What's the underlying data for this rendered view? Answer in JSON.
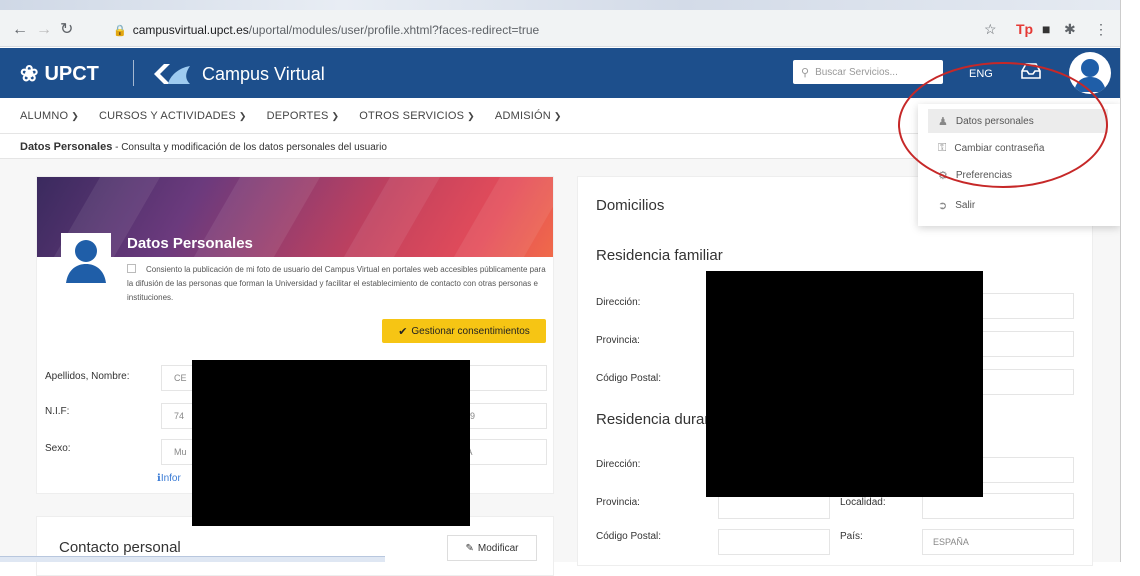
{
  "browser": {
    "url_domain": "campusvirtual.upct.es",
    "url_path": "/uportal/modules/user/profile.xhtml?faces-redirect=true"
  },
  "header": {
    "brand": "UPCT",
    "campus_title": "Campus Virtual",
    "search_placeholder": "Buscar Servicios...",
    "lang": "ENG"
  },
  "nav": {
    "items": [
      {
        "label": "ALUMNO"
      },
      {
        "label": "CURSOS Y ACTIVIDADES"
      },
      {
        "label": "DEPORTES"
      },
      {
        "label": "OTROS SERVICIOS"
      },
      {
        "label": "ADMISIÓN"
      }
    ]
  },
  "breadcrumb": {
    "title": "Datos Personales",
    "desc": " - Consulta y modificación de los datos personales del usuario"
  },
  "personal": {
    "title": "Datos Personales",
    "consent_text": "Consiento la publicación de mi foto de usuario del Campus Virtual en portales web accesibles públicamente para la difusión de las personas que forman la Universidad y facilitar el establecimiento de contacto con otras personas e instituciones.",
    "consent_button": "Gestionar consentimientos",
    "fields": [
      {
        "label": "Apellidos, Nombre:",
        "value": "CE"
      },
      {
        "label": "N.I.F:",
        "value": "74"
      },
      {
        "label": "Sexo:",
        "value": "Mu"
      }
    ],
    "nif_tail": "999",
    "sexo_tail": "NA",
    "info_link": "Infor"
  },
  "contact": {
    "title": "Contacto personal",
    "modify_button": "Modificar"
  },
  "address": {
    "title": "Domicilios",
    "family_title": "Residencia familiar",
    "during_title": "Residencia duran",
    "labels": {
      "direccion": "Dirección:",
      "provincia": "Provincia:",
      "codigo_postal": "Código Postal:",
      "localidad": "Localidad:",
      "pais": "País:"
    },
    "pais_value": "ESPAÑA"
  },
  "dropdown": {
    "items": [
      {
        "label": "Datos personales",
        "icon": "user-icon"
      },
      {
        "label": "Cambiar contraseña",
        "icon": "lock-icon"
      },
      {
        "label": "Preferencias",
        "icon": "gear-icon"
      },
      {
        "label": "Salir",
        "icon": "logout-icon"
      }
    ]
  },
  "colors": {
    "header_bg": "#1d4f8c",
    "consent_button": "#f6c514",
    "highlight_ellipse": "#c62828"
  }
}
